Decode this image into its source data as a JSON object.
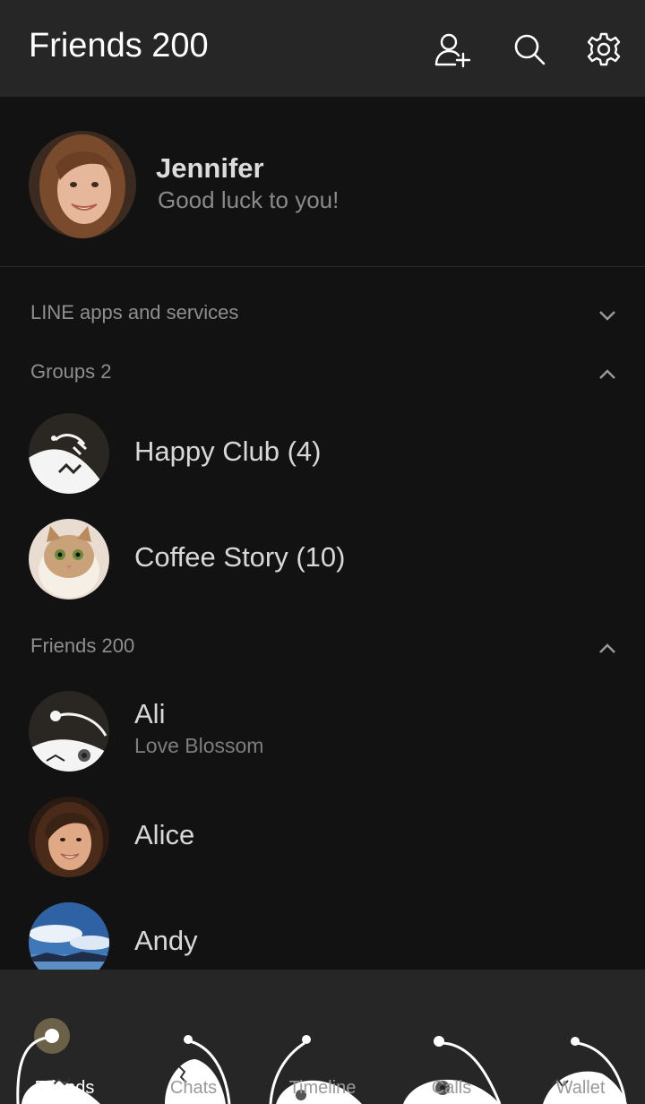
{
  "header": {
    "title": "Friends 200"
  },
  "profile": {
    "name": "Jennifer",
    "status": "Good luck to you!"
  },
  "sections": {
    "apps": "LINE apps and services",
    "groups": "Groups 2",
    "friends": "Friends 200"
  },
  "groups": [
    {
      "name": "Happy Club (4)"
    },
    {
      "name": "Coffee Story (10)"
    }
  ],
  "friends": [
    {
      "name": "Ali",
      "status": "Love Blossom"
    },
    {
      "name": "Alice"
    },
    {
      "name": "Andy"
    }
  ],
  "tabs": [
    {
      "label": "Friends",
      "icon": "friends-icon",
      "active": true
    },
    {
      "label": "Chats",
      "icon": "chats-icon"
    },
    {
      "label": "Timeline",
      "icon": "timeline-icon"
    },
    {
      "label": "Calls",
      "icon": "calls-icon"
    },
    {
      "label": "Wallet",
      "icon": "wallet-icon"
    }
  ],
  "colors": {
    "background": "#121212",
    "header": "#262626",
    "text": "#d8d8d8",
    "muted": "#8e8e8e"
  }
}
